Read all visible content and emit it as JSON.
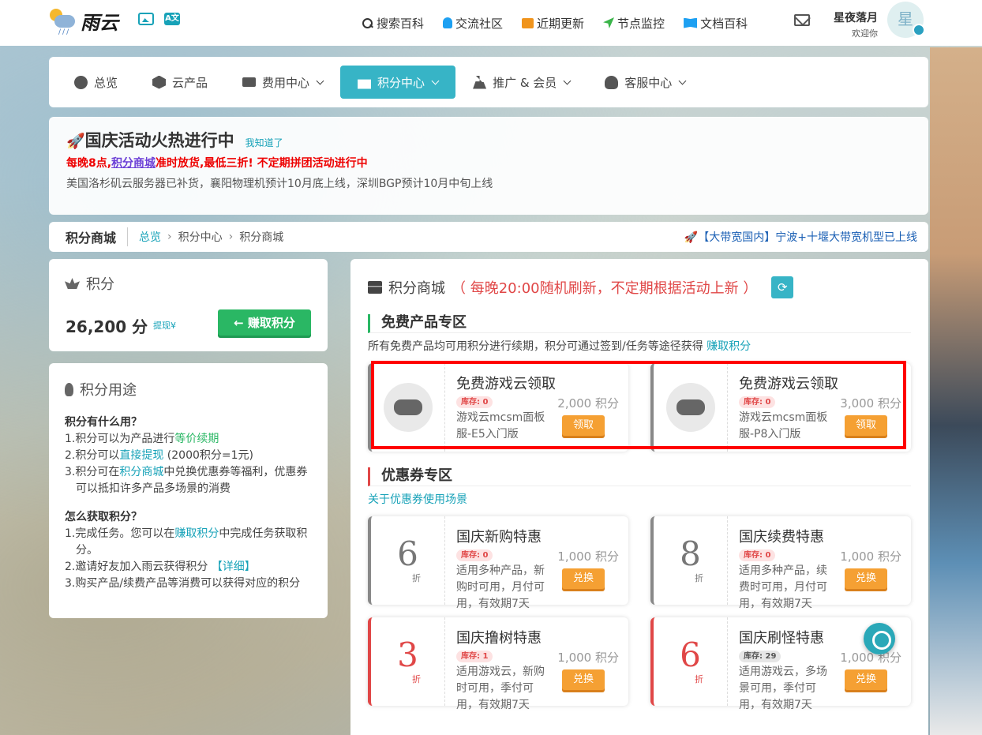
{
  "header": {
    "logo_text": "雨云",
    "icons": [
      "image-icon",
      "translate-icon"
    ],
    "translate_icon_text": "A文",
    "nav": [
      {
        "label": "搜索百科",
        "icon": "search-icon"
      },
      {
        "label": "交流社区",
        "icon": "bell-icon"
      },
      {
        "label": "近期更新",
        "icon": "news-icon"
      },
      {
        "label": "节点监控",
        "icon": "navigation-icon"
      },
      {
        "label": "文档百科",
        "icon": "book-icon"
      }
    ],
    "mail_icon": "mail-icon",
    "user": {
      "name": "星夜落月",
      "greeting": "欢迎你",
      "avatar_char": "星"
    }
  },
  "mainnav": [
    {
      "label": "总览",
      "icon": "dashboard-icon",
      "dropdown": false,
      "active": false
    },
    {
      "label": "云产品",
      "icon": "cubes-icon",
      "dropdown": false,
      "active": false
    },
    {
      "label": "费用中心",
      "icon": "money-icon",
      "dropdown": true,
      "active": false
    },
    {
      "label": "积分中心",
      "icon": "gift-icon",
      "dropdown": true,
      "active": true
    },
    {
      "label": "推广 & 会员",
      "icon": "users-icon",
      "dropdown": true,
      "active": false
    },
    {
      "label": "客服中心",
      "icon": "headset-icon",
      "dropdown": true,
      "active": false
    }
  ],
  "notice": {
    "emoji": "🚀",
    "title": "国庆活动火热进行中",
    "ack": "我知道了",
    "line1_a": "每晚8点,",
    "line1_link": "积分商城",
    "line1_b": "准时放货,最低三折! 不定期拼团活动进行中",
    "line2": "美国洛杉矶云服务器已补货，襄阳物理机预计10月底上线，深圳BGP预计10月中旬上线"
  },
  "breadcrumb": {
    "title": "积分商城",
    "items": [
      "总览",
      "积分中心",
      "积分商城"
    ],
    "sep": "›",
    "right_text": "🚀【大带宽国内】宁波+十堰大带宽机型已上线"
  },
  "points": {
    "label": "积分",
    "amount": "26,200 分",
    "withdraw": "提现¥",
    "earn_button": "← 赚取积分"
  },
  "usage": {
    "title": "积分用途",
    "q1": "积分有什么用？",
    "q1_items": [
      {
        "num": "1.",
        "pre": "积分可以为产品进行",
        "hl": "等价续期",
        "post": ""
      },
      {
        "num": "2.",
        "pre": "积分可以",
        "hl": "直接提现",
        "post": " (2000积分=1元)"
      },
      {
        "num": "3.",
        "pre": "积分可在",
        "hl": "积分商城",
        "post": "中兑换优惠券等福利，优惠券可以抵扣许多产品多场景的消费"
      }
    ],
    "q2": "怎么获取积分？",
    "q2_items": [
      {
        "num": "1.",
        "pre": "完成任务。您可以在",
        "hl": "赚取积分",
        "post": "中完成任务获取积分。"
      },
      {
        "num": "2.",
        "pre": "邀请好友加入雨云获得积分 ",
        "hl": "【详细】",
        "post": ""
      },
      {
        "num": "3.",
        "pre": "购买产品/续费产品等消费可以获得对应的积分",
        "hl": "",
        "post": ""
      }
    ]
  },
  "shop": {
    "title": "积分商城",
    "note": "（ 每晚20:00随机刷新，不定期根据活动上新 ）",
    "refresh_icon": "refresh-icon",
    "free_section": {
      "title": "免费产品专区",
      "desc_pre": "所有免费产品均可用积分进行续期，积分可通过签到/任务等途径获得 ",
      "desc_link": "赚取积分",
      "items": [
        {
          "title": "免费游戏云领取",
          "stock": "库存: 0",
          "price": "2,000 积分",
          "desc": "游戏云mcsm面板服-E5入门版",
          "button": "领取"
        },
        {
          "title": "免费游戏云领取",
          "stock": "库存: 0",
          "price": "3,000 积分",
          "desc": "游戏云mcsm面板服-P8入门版",
          "button": "领取"
        }
      ]
    },
    "coupon_section": {
      "title": "优惠券专区",
      "link": "关于优惠券使用场景",
      "items": [
        {
          "discount": "6",
          "unit": "折",
          "title": "国庆新购特惠",
          "stock": "库存: 0",
          "price": "1,000 积分",
          "desc": "适用多种产品，新购时可用，月付可用，有效期7天",
          "button": "兑换",
          "accent": "gray"
        },
        {
          "discount": "8",
          "unit": "折",
          "title": "国庆续费特惠",
          "stock": "库存: 0",
          "price": "1,000 积分",
          "desc": "适用多种产品，续费时可用，月付可用，有效期7天",
          "button": "兑换",
          "accent": "gray"
        },
        {
          "discount": "3",
          "unit": "折",
          "title": "国庆撸树特惠",
          "stock": "库存: 1",
          "price": "1,000 积分",
          "desc": "适用游戏云，新购时可用，季付可用，有效期7天",
          "button": "兑换",
          "accent": "red"
        },
        {
          "discount": "6",
          "unit": "折",
          "title": "国庆刷怪特惠",
          "stock": "库存: 29",
          "price": "1,000 积分",
          "desc": "适用游戏云，多场景可用，季付可用，有效期7天",
          "button": "兑换",
          "accent": "red"
        }
      ]
    }
  },
  "float_button_icon": "headset-icon",
  "colors": {
    "accent": "#37b4c6",
    "green": "#2ab764",
    "red": "#e04747",
    "orange": "#f5a033",
    "highlight_box": "#ff0000"
  }
}
